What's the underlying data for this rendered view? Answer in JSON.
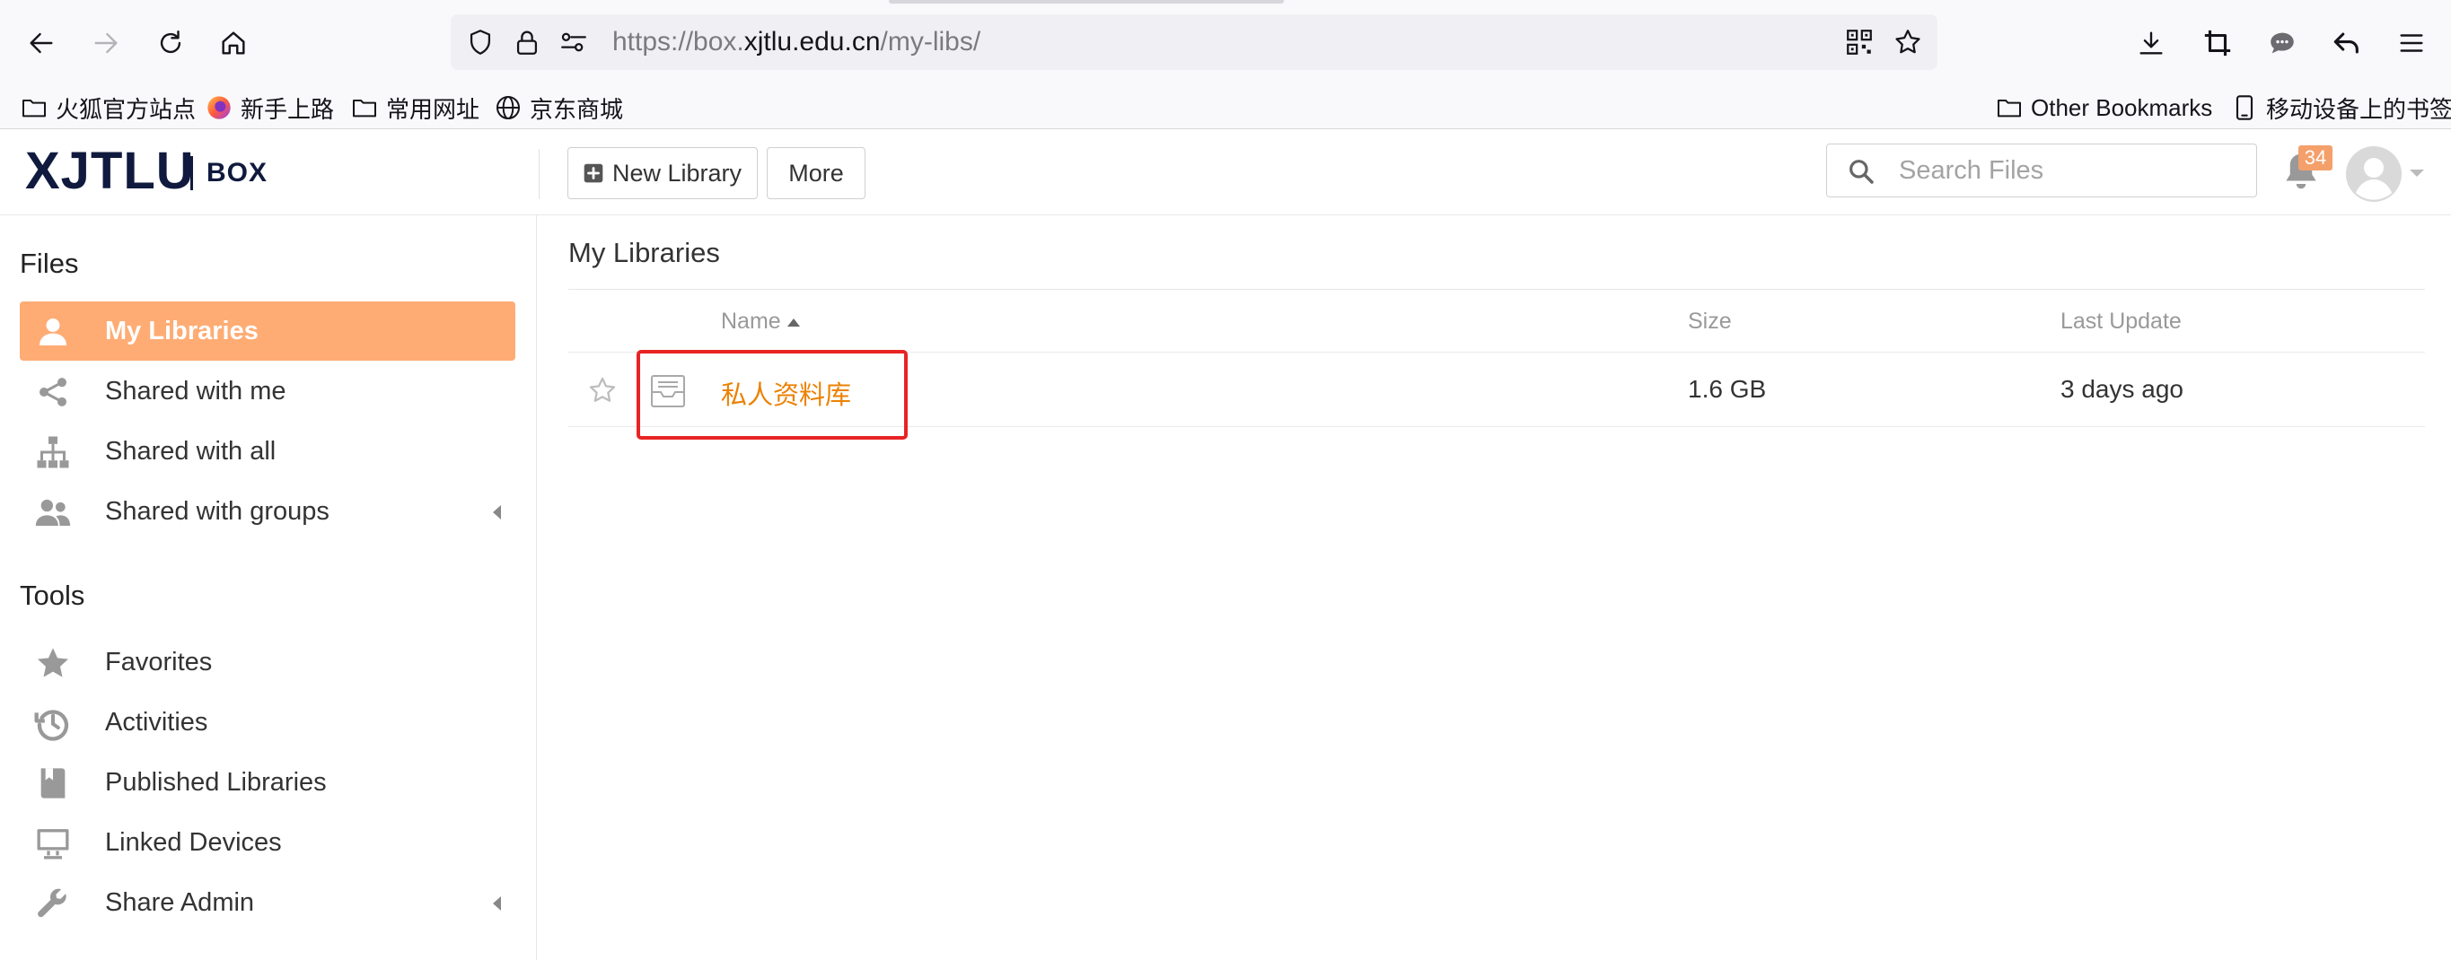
{
  "browser": {
    "url_prefix": "https://box.",
    "url_host": "xjtlu.edu.cn",
    "url_path": "/my-libs/"
  },
  "bookmarks": {
    "left": [
      {
        "label": "火狐官方站点",
        "icon": "folder-icon"
      },
      {
        "label": "新手上路",
        "icon": "firefox-icon"
      },
      {
        "label": "常用网址",
        "icon": "folder-icon"
      },
      {
        "label": "京东商城",
        "icon": "globe-icon"
      }
    ],
    "right": [
      {
        "label": "Other Bookmarks",
        "icon": "folder-icon"
      },
      {
        "label": "移动设备上的书签",
        "icon": "mobile-icon"
      }
    ]
  },
  "header": {
    "logo_main": "XJTLU",
    "logo_sub": "BOX",
    "new_library_label": "New Library",
    "more_label": "More",
    "search_placeholder": "Search Files",
    "notification_count": "34"
  },
  "sidebar": {
    "files_heading": "Files",
    "files_items": [
      {
        "label": "My Libraries",
        "icon": "user-icon",
        "active": true
      },
      {
        "label": "Shared with me",
        "icon": "share-icon"
      },
      {
        "label": "Shared with all",
        "icon": "org-chart-icon"
      },
      {
        "label": "Shared with groups",
        "icon": "group-icon",
        "expandable": true
      }
    ],
    "tools_heading": "Tools",
    "tools_items": [
      {
        "label": "Favorites",
        "icon": "star-icon"
      },
      {
        "label": "Activities",
        "icon": "history-icon"
      },
      {
        "label": "Published Libraries",
        "icon": "book-icon"
      },
      {
        "label": "Linked Devices",
        "icon": "monitor-icon"
      },
      {
        "label": "Share Admin",
        "icon": "wrench-icon",
        "expandable": true
      }
    ]
  },
  "main": {
    "title": "My Libraries",
    "columns": {
      "name": "Name",
      "size": "Size",
      "last_update": "Last Update"
    },
    "rows": [
      {
        "name": "私人资料库",
        "size": "1.6 GB",
        "last_update": "3 days ago",
        "highlighted": true
      }
    ]
  },
  "colors": {
    "accent": "#feac74",
    "link": "#eb8205",
    "logo": "#101a3e",
    "highlight_border": "#e82323",
    "badge": "#f4a06b"
  }
}
